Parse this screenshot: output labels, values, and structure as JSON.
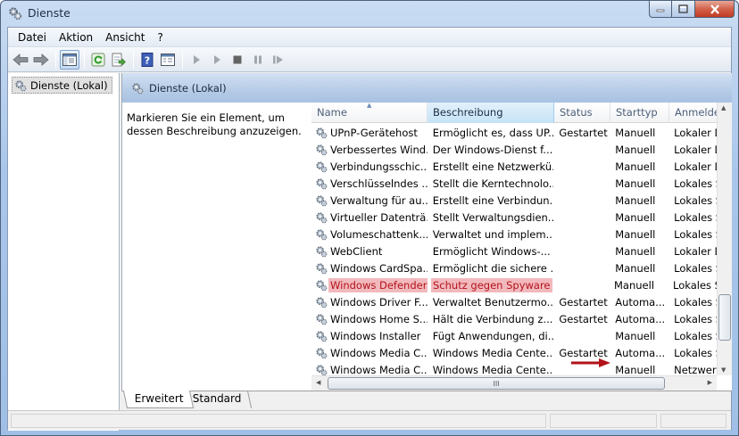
{
  "window": {
    "title": "Dienste"
  },
  "menu": [
    "Datei",
    "Aktion",
    "Ansicht",
    "?"
  ],
  "toolbar": {
    "icons": [
      "back-icon",
      "forward-icon",
      "show-hide-tree-icon",
      "refresh-icon",
      "export-icon",
      "help-icon",
      "properties-icon",
      "start-icon",
      "start-alt-icon",
      "stop-icon",
      "pause-icon",
      "restart-icon"
    ]
  },
  "tree": {
    "root_label": "Dienste (Lokal)"
  },
  "pane": {
    "header": "Dienste (Lokal)",
    "description": "Markieren Sie ein Element, um dessen Beschreibung anzuzeigen."
  },
  "list": {
    "columns": [
      "Name",
      "Beschreibung",
      "Status",
      "Starttyp",
      "Anmelde"
    ],
    "rows": [
      [
        "UPnP-Gerätehost",
        "Ermöglicht es, dass UP...",
        "Gestartet",
        "Manuell",
        "Lokaler D"
      ],
      [
        "Verbessertes Wind...",
        "Der Windows-Dienst f...",
        "",
        "Manuell",
        "Lokaler D"
      ],
      [
        "Verbindungsschic...",
        "Erstellt eine Netzwerkü...",
        "",
        "Manuell",
        "Lokaler D"
      ],
      [
        "Verschlüsselndes ...",
        "Stellt die Kerntechnolo...",
        "",
        "Manuell",
        "Lokales S"
      ],
      [
        "Verwaltung für au...",
        "Erstellt eine Verbindun...",
        "",
        "Manuell",
        "Lokales S"
      ],
      [
        "Virtueller Datenträ...",
        "Stellt Verwaltungsdien...",
        "",
        "Manuell",
        "Lokales S"
      ],
      [
        "Volumeschattenk...",
        "Verwaltet und implem...",
        "",
        "Manuell",
        "Lokales S"
      ],
      [
        "WebClient",
        "Ermöglicht Windows-...",
        "",
        "Manuell",
        "Lokaler D"
      ],
      [
        "Windows CardSpa...",
        "Ermöglicht die sichere ...",
        "",
        "Manuell",
        "Lokales S"
      ],
      [
        "Windows Defender",
        "Schutz gegen Spyware ...",
        "",
        "Manuell",
        "Lokales S"
      ],
      [
        "Windows Driver F...",
        "Verwaltet Benutzermo...",
        "Gestartet",
        "Automa...",
        "Lokales S"
      ],
      [
        "Windows Home S...",
        "Hält die Verbindung z...",
        "Gestartet",
        "Automa...",
        "Lokales S"
      ],
      [
        "Windows Installer",
        "Fügt Anwendungen, di...",
        "",
        "Manuell",
        "Lokales S"
      ],
      [
        "Windows Media C...",
        "Windows Media Cente...",
        "Gestartet",
        "Automa...",
        "Lokales S"
      ],
      [
        "Windows Media C...",
        "Windows Media Cente...",
        "",
        "Manuell",
        "Netzwerkd"
      ]
    ],
    "highlighted_row": "Windows Defender",
    "highlight_color": "#f2b9bd",
    "annotation_arrow_color": "#b3121a"
  },
  "scrollbar": {
    "thumb_label": "III"
  },
  "tabs": [
    "Erweitert",
    "Standard"
  ]
}
